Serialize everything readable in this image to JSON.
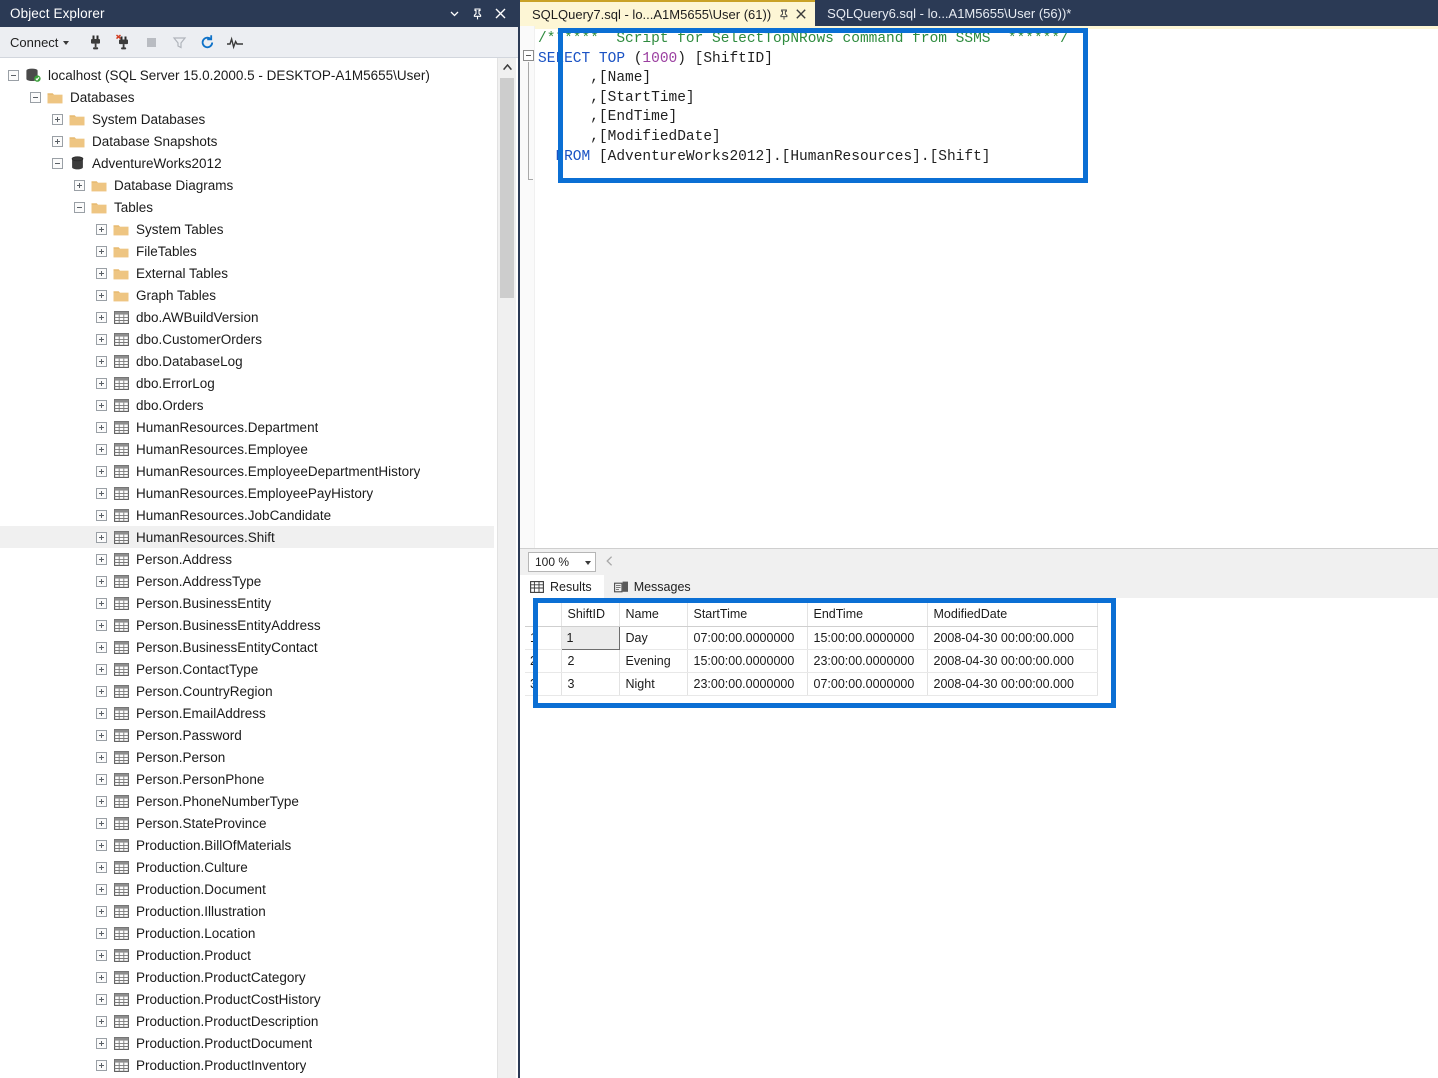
{
  "object_explorer": {
    "title": "Object Explorer",
    "titlebar_buttons": [
      {
        "name": "window-dropdown-icon",
        "glyph": "▾"
      },
      {
        "name": "pin-icon",
        "glyph": "⚲"
      },
      {
        "name": "close-icon",
        "glyph": "✕"
      }
    ],
    "toolbar": {
      "connect_label": "Connect",
      "buttons": [
        {
          "name": "connect-object-explorer-icon",
          "title": "Connect"
        },
        {
          "name": "disconnect-object-explorer-icon",
          "title": "Disconnect"
        },
        {
          "name": "stop-icon",
          "title": "Stop"
        },
        {
          "name": "filter-icon",
          "title": "Filter"
        },
        {
          "name": "refresh-icon",
          "title": "Refresh"
        },
        {
          "name": "activity-monitor-icon",
          "title": "Activity Monitor"
        }
      ]
    },
    "tree": [
      {
        "label": "localhost (SQL Server 15.0.2000.5 - DESKTOP-A1M5655\\User)",
        "depth": 0,
        "toggle": "minus",
        "icon": "server-icon"
      },
      {
        "label": "Databases",
        "depth": 1,
        "toggle": "minus",
        "icon": "folder-icon"
      },
      {
        "label": "System Databases",
        "depth": 2,
        "toggle": "plus",
        "icon": "folder-icon"
      },
      {
        "label": "Database Snapshots",
        "depth": 2,
        "toggle": "plus",
        "icon": "folder-icon"
      },
      {
        "label": "AdventureWorks2012",
        "depth": 2,
        "toggle": "minus",
        "icon": "database-icon"
      },
      {
        "label": "Database Diagrams",
        "depth": 3,
        "toggle": "plus",
        "icon": "folder-icon"
      },
      {
        "label": "Tables",
        "depth": 3,
        "toggle": "minus",
        "icon": "folder-icon"
      },
      {
        "label": "System Tables",
        "depth": 4,
        "toggle": "plus",
        "icon": "folder-icon"
      },
      {
        "label": "FileTables",
        "depth": 4,
        "toggle": "plus",
        "icon": "folder-icon"
      },
      {
        "label": "External Tables",
        "depth": 4,
        "toggle": "plus",
        "icon": "folder-icon"
      },
      {
        "label": "Graph Tables",
        "depth": 4,
        "toggle": "plus",
        "icon": "folder-icon"
      },
      {
        "label": "dbo.AWBuildVersion",
        "depth": 4,
        "toggle": "plus",
        "icon": "table-icon"
      },
      {
        "label": "dbo.CustomerOrders",
        "depth": 4,
        "toggle": "plus",
        "icon": "table-icon"
      },
      {
        "label": "dbo.DatabaseLog",
        "depth": 4,
        "toggle": "plus",
        "icon": "table-icon"
      },
      {
        "label": "dbo.ErrorLog",
        "depth": 4,
        "toggle": "plus",
        "icon": "table-icon"
      },
      {
        "label": "dbo.Orders",
        "depth": 4,
        "toggle": "plus",
        "icon": "table-icon"
      },
      {
        "label": "HumanResources.Department",
        "depth": 4,
        "toggle": "plus",
        "icon": "table-icon"
      },
      {
        "label": "HumanResources.Employee",
        "depth": 4,
        "toggle": "plus",
        "icon": "table-icon"
      },
      {
        "label": "HumanResources.EmployeeDepartmentHistory",
        "depth": 4,
        "toggle": "plus",
        "icon": "table-icon"
      },
      {
        "label": "HumanResources.EmployeePayHistory",
        "depth": 4,
        "toggle": "plus",
        "icon": "table-icon"
      },
      {
        "label": "HumanResources.JobCandidate",
        "depth": 4,
        "toggle": "plus",
        "icon": "table-icon"
      },
      {
        "label": "HumanResources.Shift",
        "depth": 4,
        "toggle": "plus",
        "icon": "table-icon",
        "highlighted": true
      },
      {
        "label": "Person.Address",
        "depth": 4,
        "toggle": "plus",
        "icon": "table-icon"
      },
      {
        "label": "Person.AddressType",
        "depth": 4,
        "toggle": "plus",
        "icon": "table-icon"
      },
      {
        "label": "Person.BusinessEntity",
        "depth": 4,
        "toggle": "plus",
        "icon": "table-icon"
      },
      {
        "label": "Person.BusinessEntityAddress",
        "depth": 4,
        "toggle": "plus",
        "icon": "table-icon"
      },
      {
        "label": "Person.BusinessEntityContact",
        "depth": 4,
        "toggle": "plus",
        "icon": "table-icon"
      },
      {
        "label": "Person.ContactType",
        "depth": 4,
        "toggle": "plus",
        "icon": "table-icon"
      },
      {
        "label": "Person.CountryRegion",
        "depth": 4,
        "toggle": "plus",
        "icon": "table-icon"
      },
      {
        "label": "Person.EmailAddress",
        "depth": 4,
        "toggle": "plus",
        "icon": "table-icon"
      },
      {
        "label": "Person.Password",
        "depth": 4,
        "toggle": "plus",
        "icon": "table-icon"
      },
      {
        "label": "Person.Person",
        "depth": 4,
        "toggle": "plus",
        "icon": "table-icon"
      },
      {
        "label": "Person.PersonPhone",
        "depth": 4,
        "toggle": "plus",
        "icon": "table-icon"
      },
      {
        "label": "Person.PhoneNumberType",
        "depth": 4,
        "toggle": "plus",
        "icon": "table-icon"
      },
      {
        "label": "Person.StateProvince",
        "depth": 4,
        "toggle": "plus",
        "icon": "table-icon"
      },
      {
        "label": "Production.BillOfMaterials",
        "depth": 4,
        "toggle": "plus",
        "icon": "table-icon"
      },
      {
        "label": "Production.Culture",
        "depth": 4,
        "toggle": "plus",
        "icon": "table-icon"
      },
      {
        "label": "Production.Document",
        "depth": 4,
        "toggle": "plus",
        "icon": "table-icon"
      },
      {
        "label": "Production.Illustration",
        "depth": 4,
        "toggle": "plus",
        "icon": "table-icon"
      },
      {
        "label": "Production.Location",
        "depth": 4,
        "toggle": "plus",
        "icon": "table-icon"
      },
      {
        "label": "Production.Product",
        "depth": 4,
        "toggle": "plus",
        "icon": "table-icon"
      },
      {
        "label": "Production.ProductCategory",
        "depth": 4,
        "toggle": "plus",
        "icon": "table-icon"
      },
      {
        "label": "Production.ProductCostHistory",
        "depth": 4,
        "toggle": "plus",
        "icon": "table-icon"
      },
      {
        "label": "Production.ProductDescription",
        "depth": 4,
        "toggle": "plus",
        "icon": "table-icon"
      },
      {
        "label": "Production.ProductDocument",
        "depth": 4,
        "toggle": "plus",
        "icon": "table-icon"
      },
      {
        "label": "Production.ProductInventory",
        "depth": 4,
        "toggle": "plus",
        "icon": "table-icon"
      }
    ]
  },
  "tabs": [
    {
      "label": "SQLQuery7.sql - lo...A1M5655\\User (61))",
      "active": true,
      "pin_glyph": "⚲",
      "close_glyph": "✕"
    },
    {
      "label": "SQLQuery6.sql - lo...A1M5655\\User (56))*",
      "active": false
    }
  ],
  "editor": {
    "lines": [
      {
        "type": "comment",
        "text": "/******  Script for SelectTopNRows command from SSMS  ******/"
      },
      {
        "type": "code",
        "parts": [
          {
            "cls": "c-keyword",
            "t": "SELECT TOP "
          },
          {
            "cls": "c-bracket",
            "t": "("
          },
          {
            "cls": "c-number",
            "t": "1000"
          },
          {
            "cls": "c-bracket",
            "t": ") "
          },
          {
            "cls": "c-ident",
            "t": "[ShiftID]"
          }
        ]
      },
      {
        "type": "code",
        "parts": [
          {
            "cls": "c-ident",
            "t": "      ,[Name]"
          }
        ]
      },
      {
        "type": "code",
        "parts": [
          {
            "cls": "c-ident",
            "t": "      ,[StartTime]"
          }
        ]
      },
      {
        "type": "code",
        "parts": [
          {
            "cls": "c-ident",
            "t": "      ,[EndTime]"
          }
        ]
      },
      {
        "type": "code",
        "parts": [
          {
            "cls": "c-ident",
            "t": "      ,[ModifiedDate]"
          }
        ]
      },
      {
        "type": "code",
        "parts": [
          {
            "cls": "c-keyword",
            "t": "  FROM "
          },
          {
            "cls": "c-ident",
            "t": "[AdventureWorks2012].[HumanResources].[Shift]"
          }
        ]
      }
    ],
    "zoom_level": "100 %"
  },
  "results_pane": {
    "tabs": [
      {
        "label": "Results",
        "icon": "grid-icon",
        "active": true
      },
      {
        "label": "Messages",
        "icon": "messages-icon",
        "active": false
      }
    ],
    "grid": {
      "row_header_label": "",
      "columns": [
        "ShiftID",
        "Name",
        "StartTime",
        "EndTime",
        "ModifiedDate"
      ],
      "rows": [
        {
          "n": "1",
          "cells": [
            "1",
            "Day",
            "07:00:00.0000000",
            "15:00:00.0000000",
            "2008-04-30 00:00:00.000"
          ],
          "selected_cell": 0
        },
        {
          "n": "2",
          "cells": [
            "2",
            "Evening",
            "15:00:00.0000000",
            "23:00:00.0000000",
            "2008-04-30 00:00:00.000"
          ]
        },
        {
          "n": "3",
          "cells": [
            "3",
            "Night",
            "23:00:00.0000000",
            "07:00:00.0000000",
            "2008-04-30 00:00:00.000"
          ]
        }
      ]
    }
  },
  "annotations": {
    "highlight_color": "#0b6fd4",
    "boxes": [
      "code-query-highlight",
      "results-grid-highlight"
    ]
  }
}
